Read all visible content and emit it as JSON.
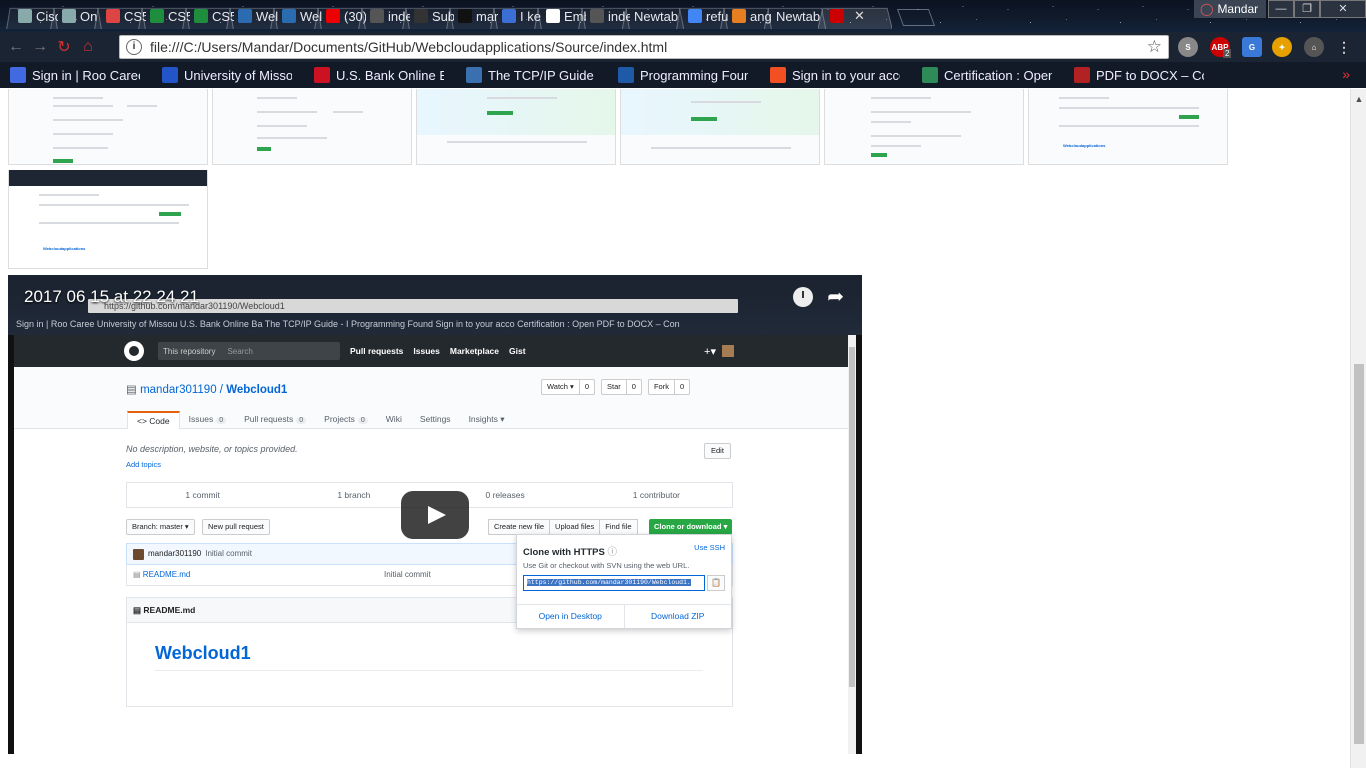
{
  "browser": {
    "profile_name": "Mandar",
    "tabs": [
      {
        "label": "Cisc",
        "color": "#8aa"
      },
      {
        "label": "On",
        "color": "#8aa"
      },
      {
        "label": "CS5",
        "color": "#d44"
      },
      {
        "label": "CS5",
        "color": "#1e8e3e"
      },
      {
        "label": "CS5",
        "color": "#1e8e3e"
      },
      {
        "label": "Wel",
        "color": "#2b6cb0"
      },
      {
        "label": "Wel",
        "color": "#2b6cb0"
      },
      {
        "label": "(30)",
        "color": "#e00"
      },
      {
        "label": "inde",
        "color": "#555"
      },
      {
        "label": "Sub",
        "color": "#333"
      },
      {
        "label": "mar",
        "color": "#111"
      },
      {
        "label": "I ke",
        "color": "#3b6fd4"
      },
      {
        "label": "Emb",
        "color": "#fff"
      },
      {
        "label": "inde",
        "color": "#555"
      },
      {
        "label": "Newtab",
        "color": ""
      },
      {
        "label": "refu",
        "color": "#4285f4"
      },
      {
        "label": "ang",
        "color": "#e67e22"
      },
      {
        "label": "Newtab",
        "color": ""
      },
      {
        "label": "",
        "color": "#c00"
      }
    ],
    "address": "file:///C:/Users/Mandar/Documents/GitHub/Webcloudapplications/Source/index.html",
    "abp_badge": "2",
    "bookmarks": [
      {
        "label": "Sign in | Roo Career",
        "color": "#4169e1"
      },
      {
        "label": "University of Missou",
        "color": "#2355c8"
      },
      {
        "label": "U.S. Bank Online Ban",
        "color": "#cc1122"
      },
      {
        "label": "The TCP/IP Guide - I",
        "color": "#3a6fb0"
      },
      {
        "label": "Programming Found",
        "color": "#1e5aa8"
      },
      {
        "label": "Sign in to your acco",
        "color": "#f25022"
      },
      {
        "label": "Certification : Open",
        "color": "#2e8b57"
      },
      {
        "label": "PDF to DOCX – Conv",
        "color": "#b22222"
      }
    ]
  },
  "video": {
    "title": "2017 06 15 at 22 24 21",
    "inner": {
      "address": "https://github.com/mandar301190/Webcloud1",
      "bookmarks_line": "Sign in | Roo Caree   University of Missou   U.S. Bank Online Ba   The TCP/IP Guide - I   Programming Found   Sign in to your acco   Certification : Open   PDF to DOCX – Con",
      "search_context": "This repository",
      "search_placeholder": "Search",
      "nav": [
        "Pull requests",
        "Issues",
        "Marketplace",
        "Gist"
      ],
      "owner": "mandar301190",
      "repo": "Webcloud1",
      "watch": "Watch ▾",
      "watch_count": "0",
      "star": "Star",
      "star_count": "0",
      "fork": "Fork",
      "fork_count": "0",
      "tabs": [
        {
          "label": "<> Code",
          "count": ""
        },
        {
          "label": "Issues",
          "count": "0"
        },
        {
          "label": "Pull requests",
          "count": "0"
        },
        {
          "label": "Projects",
          "count": "0"
        },
        {
          "label": "Wiki",
          "count": ""
        },
        {
          "label": "Settings",
          "count": ""
        },
        {
          "label": "Insights ▾",
          "count": ""
        }
      ],
      "description": "No description, website, or topics provided.",
      "add_topics": "Add topics",
      "edit": "Edit",
      "summary": [
        "1 commit",
        "1 branch",
        "0 releases",
        "1 contributor"
      ],
      "branch": "Branch: master ▾",
      "new_pr": "New pull request",
      "file_buttons": [
        "Create new file",
        "Upload files",
        "Find file"
      ],
      "clone_button": "Clone or download ▾",
      "commit_author": "mandar301190",
      "commit_msg": "Initial commit",
      "file_name": "README.md",
      "file_msg": "Initial commit",
      "readme_header": "README.md",
      "readme_title": "Webcloud1",
      "clone": {
        "title": "Clone with HTTPS",
        "use_ssh": "Use SSH",
        "desc": "Use Git or checkout with SVN using the web URL.",
        "url": "https://github.com/mandar301190/Webcloud1.",
        "open_desktop": "Open in Desktop",
        "download_zip": "Download ZIP"
      }
    }
  }
}
